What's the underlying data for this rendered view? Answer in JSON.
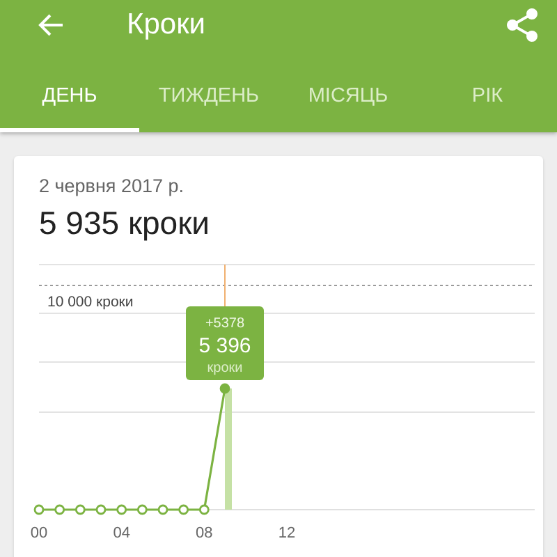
{
  "app_bar": {
    "title": "Кроки"
  },
  "tabs": [
    {
      "label": "ДЕНЬ",
      "selected": true
    },
    {
      "label": "ТИЖДЕНЬ",
      "selected": false
    },
    {
      "label": "МІСЯЦЬ",
      "selected": false
    },
    {
      "label": "РІК",
      "selected": false
    }
  ],
  "card": {
    "date": "2 червня 2017 р.",
    "total": "5 935 кроки",
    "chart": {
      "goal_label": "10 000 кроки",
      "tooltip": {
        "delta": "+5378",
        "value": "5 396",
        "unit": "кроки"
      },
      "x_labels": [
        "00",
        "04",
        "08",
        "12"
      ]
    }
  }
}
